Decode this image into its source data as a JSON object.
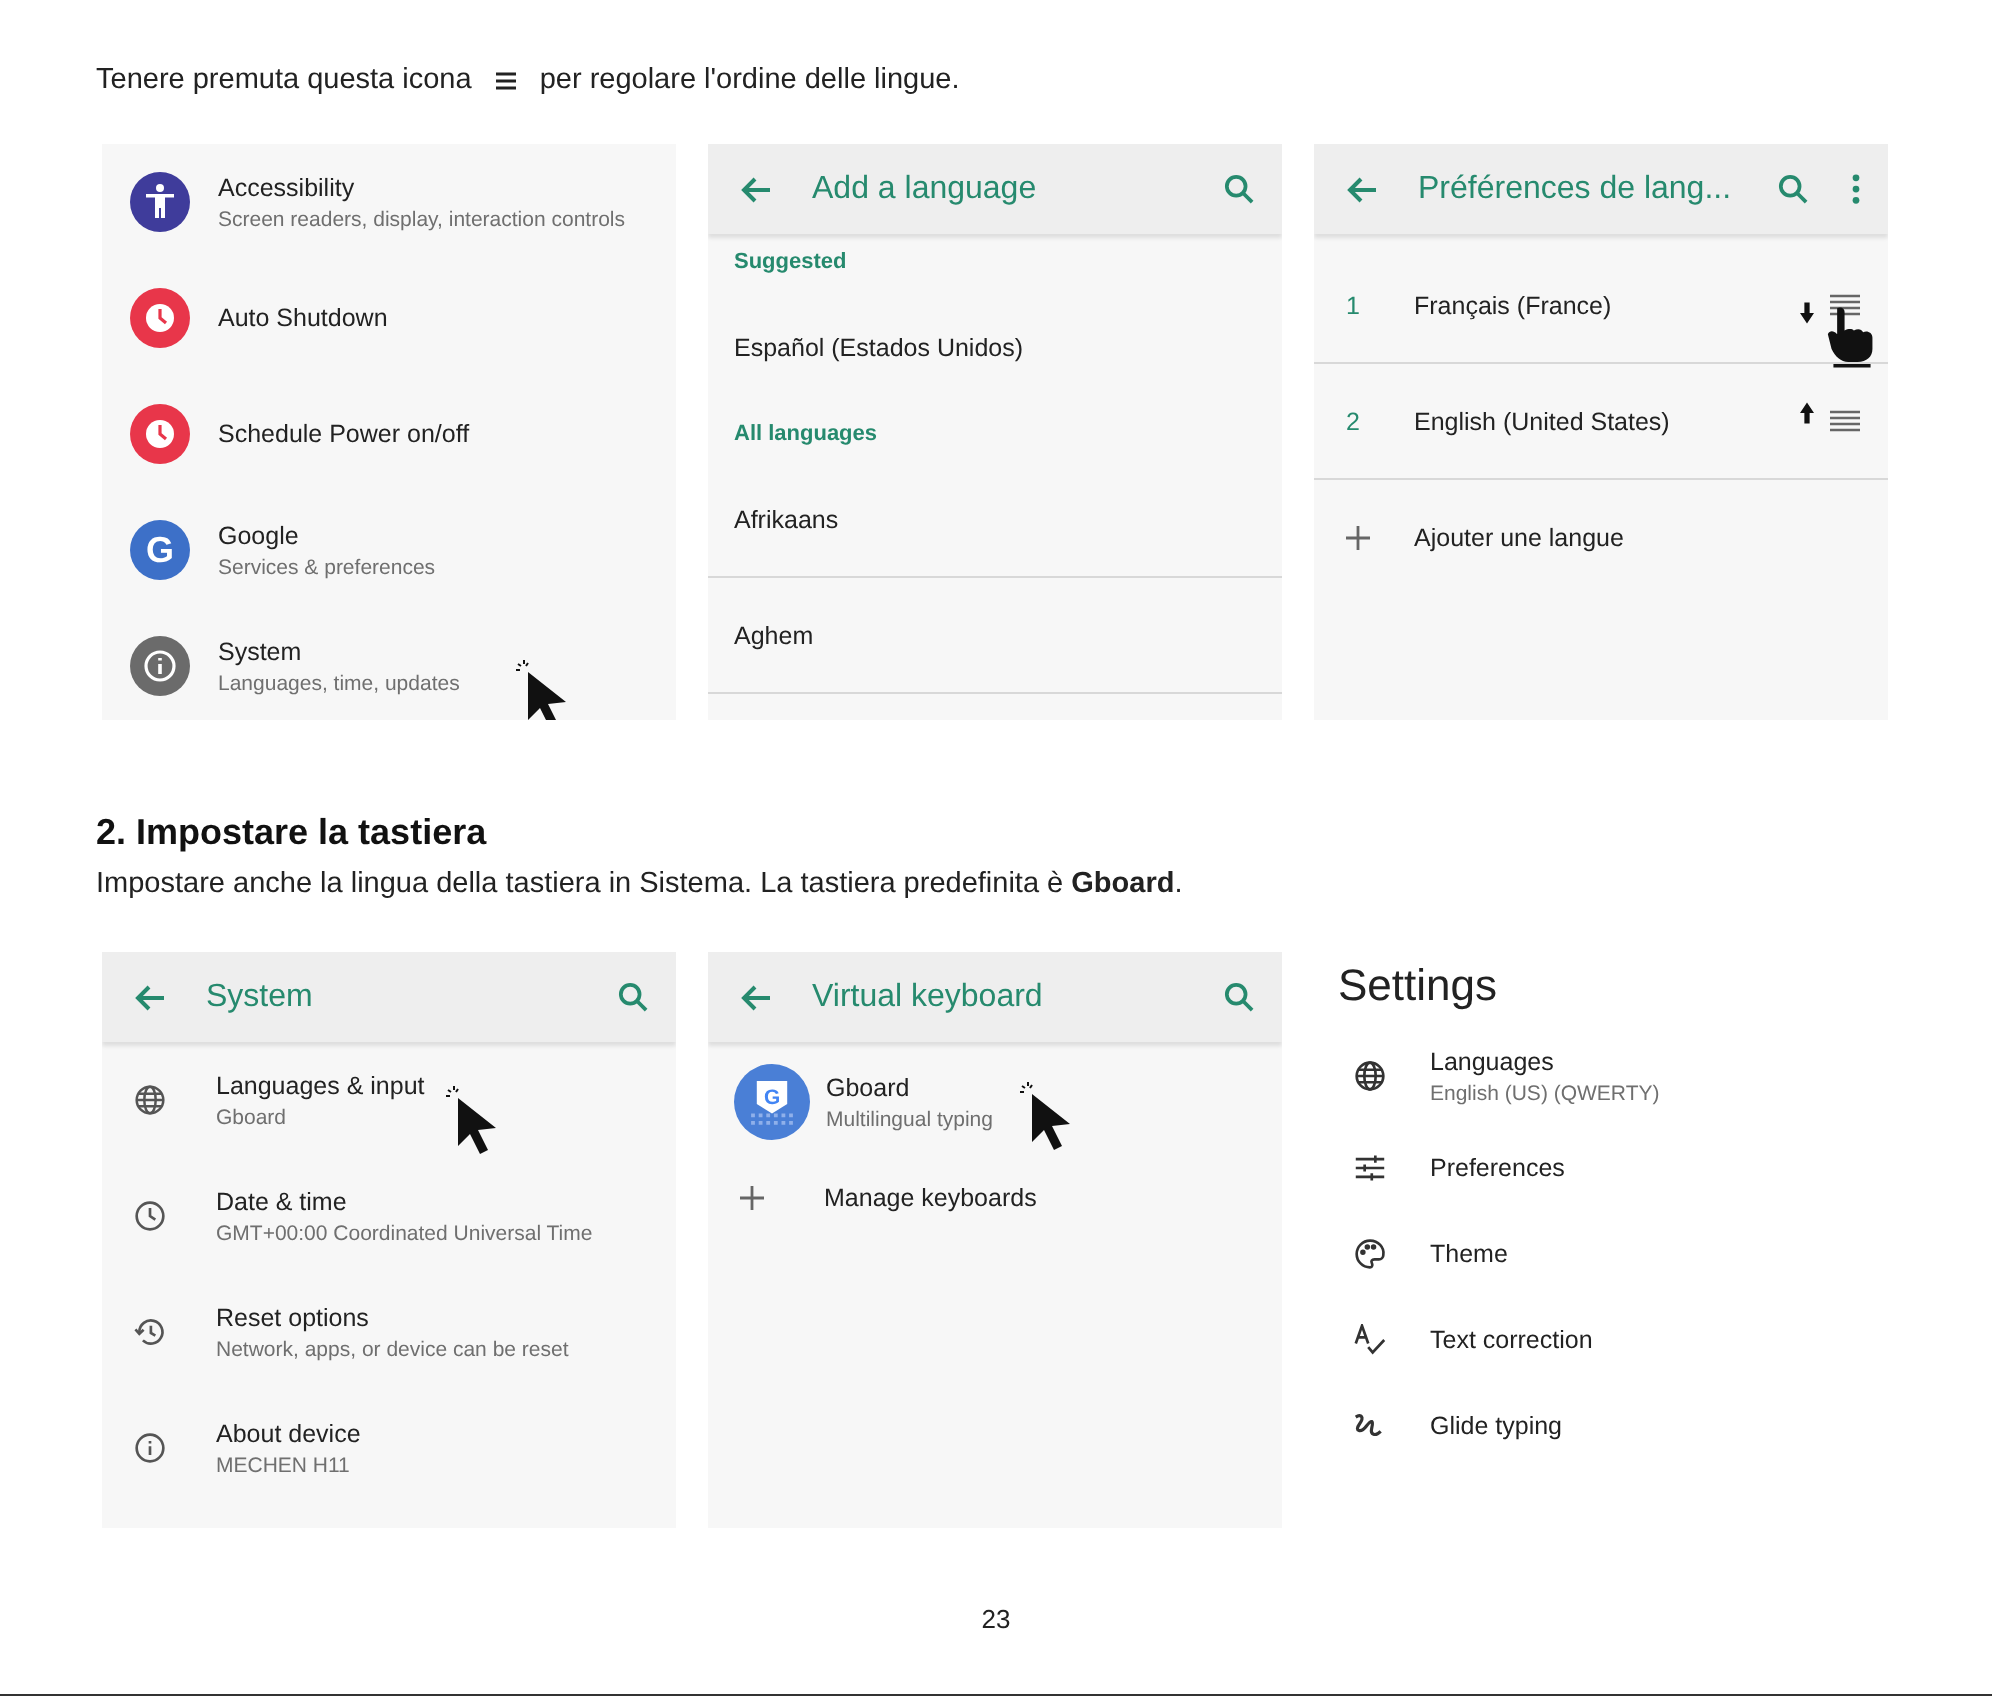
{
  "intro": {
    "before": "Tenere premuta questa icona",
    "after": "per regolare l'ordine delle lingue."
  },
  "settings_panel": {
    "items": [
      {
        "kind": "accessibility",
        "color": "#3f3c9b",
        "title": "Accessibility",
        "subtitle": "Screen readers, display, interaction controls",
        "pointer": false
      },
      {
        "kind": "clock",
        "color": "#e8364a",
        "title": "Auto Shutdown",
        "pointer": false
      },
      {
        "kind": "clock",
        "color": "#e8364a",
        "title": "Schedule Power on/off",
        "pointer": false
      },
      {
        "kind": "google",
        "color": "#3d70c8",
        "logo_letter": "G",
        "title": "Google",
        "subtitle": "Services & preferences",
        "pointer": false
      },
      {
        "kind": "info",
        "color": "#6b6b6b",
        "title": "System",
        "subtitle": "Languages, time, updates",
        "pointer": true
      }
    ]
  },
  "add_language": {
    "title": "Add a language",
    "rows": [
      {
        "kind": "section",
        "label": "Suggested"
      },
      {
        "kind": "item",
        "label": "Español (Estados Unidos)",
        "divider": false
      },
      {
        "kind": "section",
        "label": "All languages"
      },
      {
        "kind": "item",
        "label": "Afrikaans",
        "divider": true
      },
      {
        "kind": "item",
        "label": "Aghem",
        "divider": true
      }
    ]
  },
  "language_prefs": {
    "title": "Préférences de lang...",
    "languages": [
      {
        "number": "1",
        "label": "Français (France)",
        "kind": "down",
        "dragging": true
      },
      {
        "number": "2",
        "label": "English (United States)",
        "kind": "up",
        "dragging": false
      }
    ],
    "add_label": "Ajouter une langue"
  },
  "heading": "2. Impostare la tastiera",
  "paragraph": "Impostare anche la lingua della tastiera in Sistema. La tastiera predefinita è **Gboard**.",
  "system_panel": {
    "title": "System",
    "items": [
      {
        "kind": "globe",
        "title": "Languages & input",
        "subtitle": "Gboard",
        "pointer": true
      },
      {
        "kind": "clock",
        "title": "Date & time",
        "subtitle": "GMT+00:00 Coordinated Universal Time",
        "pointer": false
      },
      {
        "kind": "reset",
        "title": "Reset options",
        "subtitle": "Network, apps, or device can be reset",
        "pointer": false
      },
      {
        "kind": "info",
        "title": "About device",
        "subtitle": "MECHEN H11",
        "pointer": false
      }
    ]
  },
  "keyboard_panel": {
    "title": "Virtual keyboard",
    "keyboard": {
      "logo_letter": "G",
      "title": "Gboard",
      "subtitle": "Multilingual typing",
      "pointer": true
    },
    "manage_label": "Manage keyboards"
  },
  "gboard_settings": {
    "title": "Settings",
    "items": [
      {
        "kind": "globe",
        "title": "Languages",
        "subtitle": "English (US) (QWERTY)"
      },
      {
        "kind": "sliders",
        "title": "Preferences"
      },
      {
        "kind": "palette",
        "title": "Theme"
      },
      {
        "kind": "spell",
        "title": "Text correction"
      },
      {
        "kind": "glide",
        "title": "Glide typing"
      }
    ]
  },
  "page_number": "23"
}
